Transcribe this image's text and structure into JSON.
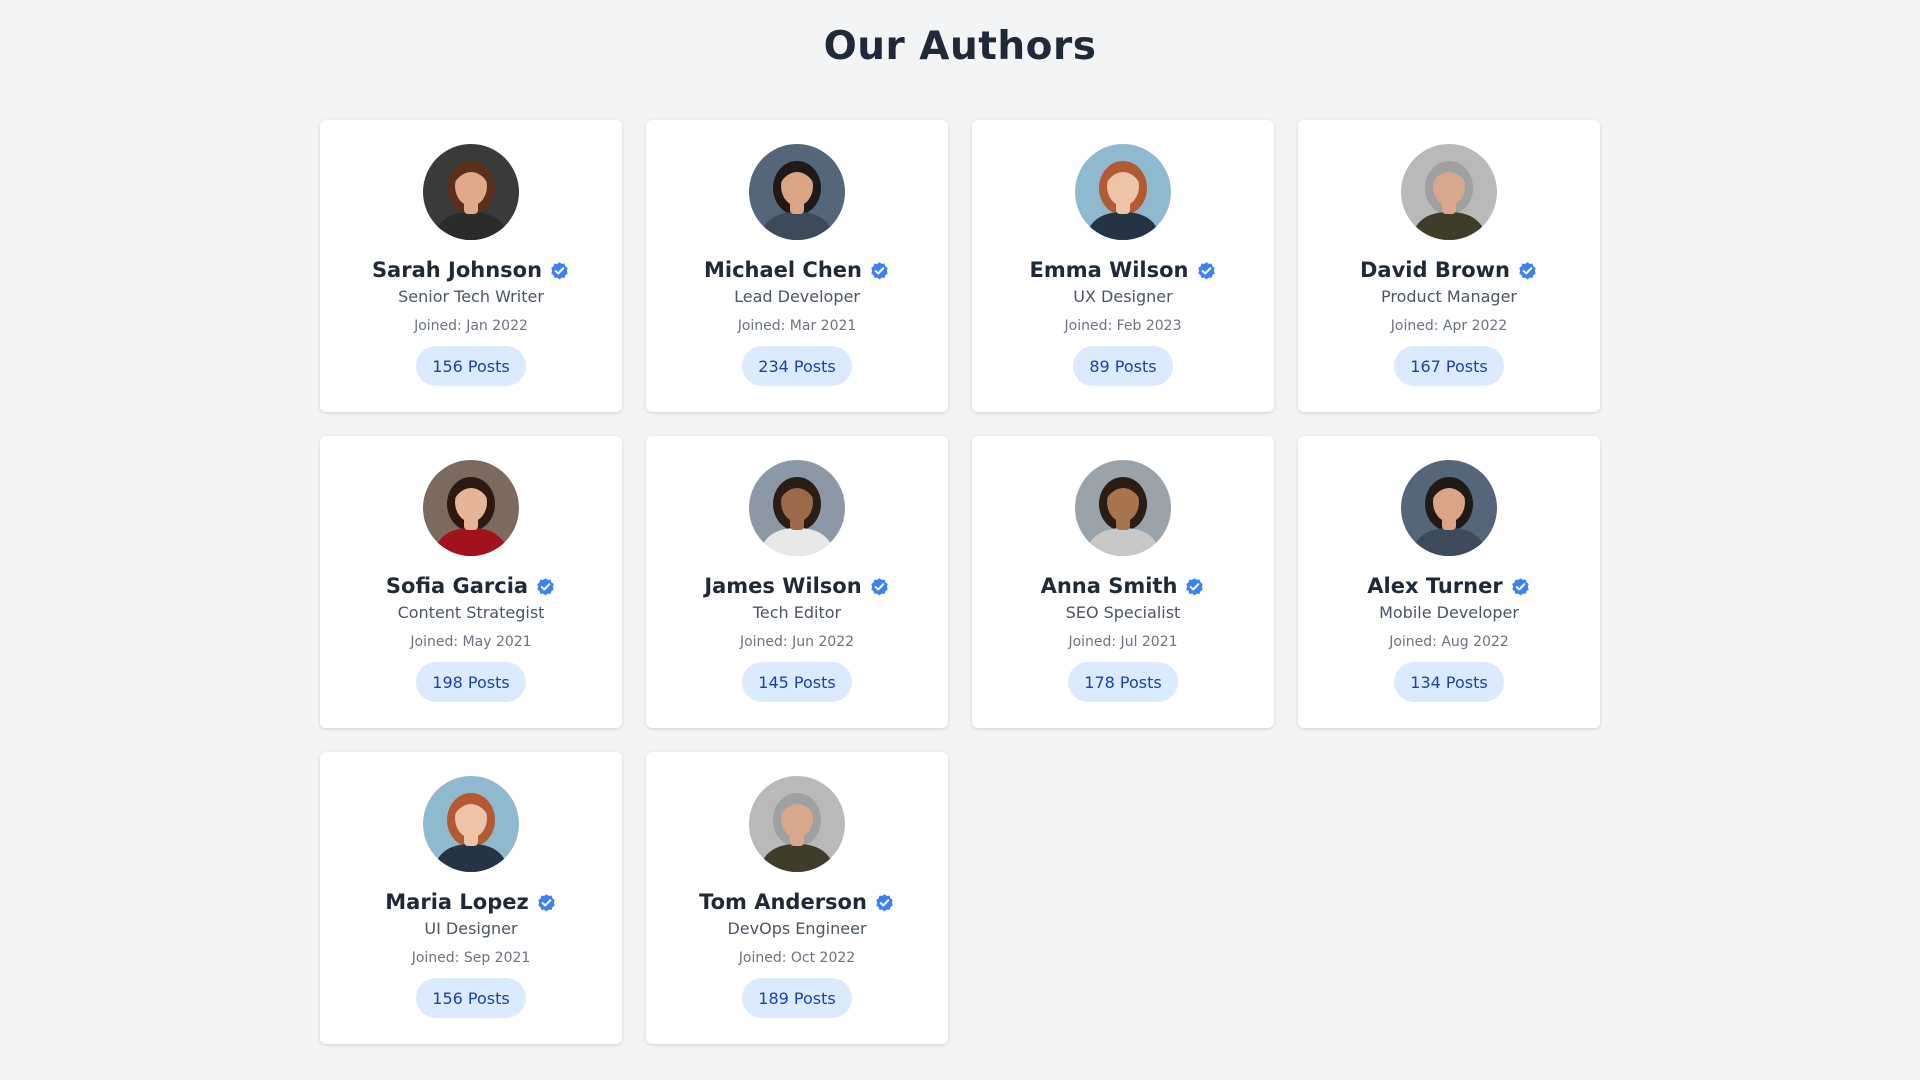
{
  "page": {
    "title": "Our Authors",
    "background": "#f3f4f6"
  },
  "colors": {
    "verified": "#3b82f6",
    "badge_bg": "#dbeafe",
    "badge_text": "#1e40af",
    "heading": "#1f2937"
  },
  "authors": [
    {
      "name": "Sarah Johnson",
      "role": "Senior Tech Writer",
      "joined": "Joined: Jan 2022",
      "posts": "156 Posts",
      "verified_icon": "verified-check-icon",
      "avatar": {
        "bg": "#3a3a3a",
        "skin": "#e0a98a",
        "hair": "#5a2f1c",
        "shirt": "#2b2b2b"
      }
    },
    {
      "name": "Michael Chen",
      "role": "Lead Developer",
      "joined": "Joined: Mar 2021",
      "posts": "234 Posts",
      "verified_icon": "verified-check-icon",
      "avatar": {
        "bg": "#55657a",
        "skin": "#d9a585",
        "hair": "#1f1a17",
        "shirt": "#3d4a5a"
      }
    },
    {
      "name": "Emma Wilson",
      "role": "UX Designer",
      "joined": "Joined: Feb 2023",
      "posts": "89 Posts",
      "verified_icon": "verified-check-icon",
      "avatar": {
        "bg": "#8fb9cf",
        "skin": "#efc3a8",
        "hair": "#b35a32",
        "shirt": "#243444"
      }
    },
    {
      "name": "David Brown",
      "role": "Product Manager",
      "joined": "Joined: Apr 2022",
      "posts": "167 Posts",
      "verified_icon": "verified-check-icon",
      "avatar": {
        "bg": "#b9b9b9",
        "skin": "#d8a88e",
        "hair": "#a0a0a0",
        "shirt": "#3f3d2a"
      }
    },
    {
      "name": "Sofia Garcia",
      "role": "Content Strategist",
      "joined": "Joined: May 2021",
      "posts": "198 Posts",
      "verified_icon": "verified-check-icon",
      "avatar": {
        "bg": "#7d6a5f",
        "skin": "#e6b496",
        "hair": "#2c1a12",
        "shirt": "#a3121f"
      }
    },
    {
      "name": "James Wilson",
      "role": "Tech Editor",
      "joined": "Joined: Jun 2022",
      "posts": "145 Posts",
      "verified_icon": "verified-check-icon",
      "avatar": {
        "bg": "#8d98a6",
        "skin": "#9c6a4a",
        "hair": "#2a1d16",
        "shirt": "#e8e8e8"
      }
    },
    {
      "name": "Anna Smith",
      "role": "SEO Specialist",
      "joined": "Joined: Jul 2021",
      "posts": "178 Posts",
      "verified_icon": "verified-check-icon",
      "avatar": {
        "bg": "#9aa3aa",
        "skin": "#a8734f",
        "hair": "#2b1d16",
        "shirt": "#c8c8c8"
      }
    },
    {
      "name": "Alex Turner",
      "role": "Mobile Developer",
      "joined": "Joined: Aug 2022",
      "posts": "134 Posts",
      "verified_icon": "verified-check-icon",
      "avatar": {
        "bg": "#55657a",
        "skin": "#d9a585",
        "hair": "#1f1a17",
        "shirt": "#3d4a5a"
      }
    },
    {
      "name": "Maria Lopez",
      "role": "UI Designer",
      "joined": "Joined: Sep 2021",
      "posts": "156 Posts",
      "verified_icon": "verified-check-icon",
      "avatar": {
        "bg": "#8fb9cf",
        "skin": "#efc3a8",
        "hair": "#b35a32",
        "shirt": "#243444"
      }
    },
    {
      "name": "Tom Anderson",
      "role": "DevOps Engineer",
      "joined": "Joined: Oct 2022",
      "posts": "189 Posts",
      "verified_icon": "verified-check-icon",
      "avatar": {
        "bg": "#b9b9b9",
        "skin": "#d8a88e",
        "hair": "#a0a0a0",
        "shirt": "#3f3d2a"
      }
    }
  ]
}
